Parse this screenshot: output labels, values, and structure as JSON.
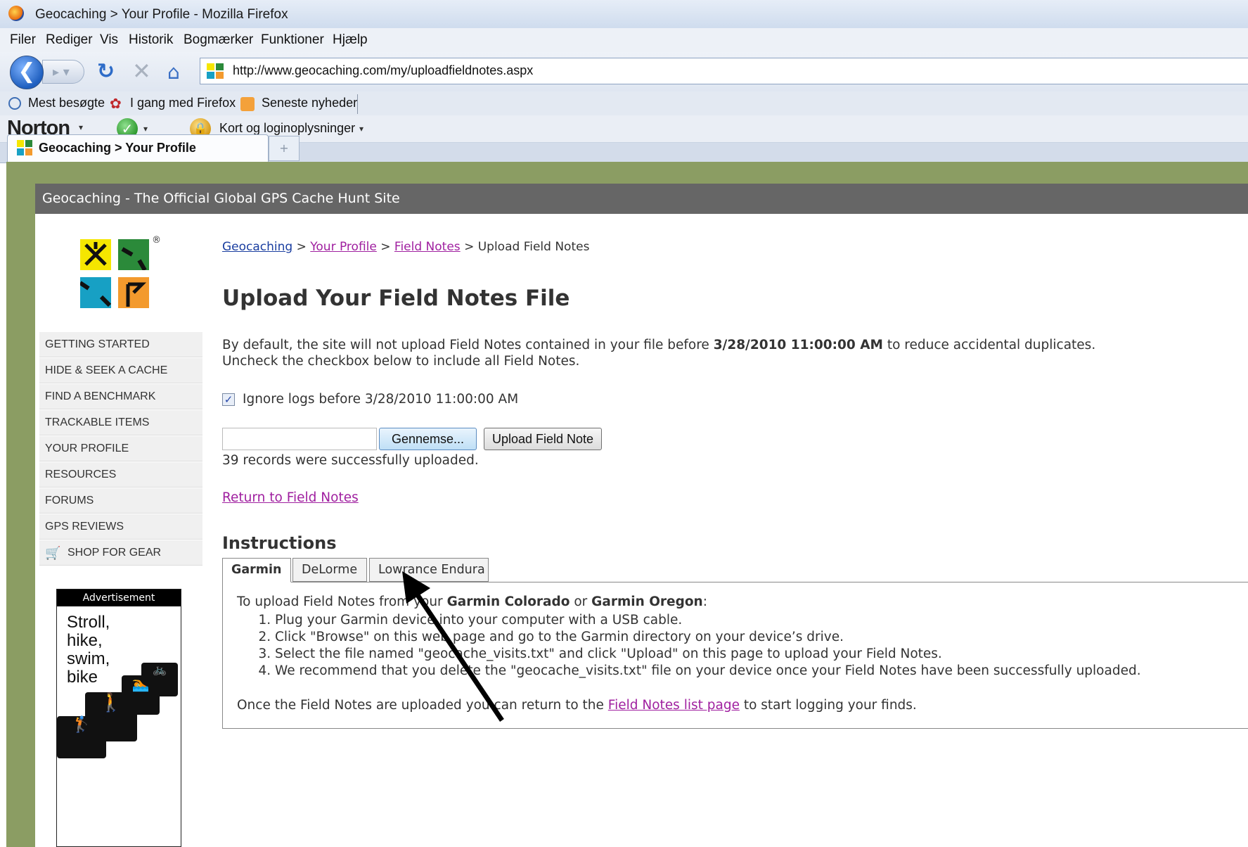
{
  "window": {
    "title": "Geocaching > Your Profile - Mozilla Firefox"
  },
  "menubar": {
    "items": [
      "Filer",
      "Rediger",
      "Vis",
      "Historik",
      "Bogmærker",
      "Funktioner",
      "Hjælp"
    ]
  },
  "navbar": {
    "url": "http://www.geocaching.com/my/uploadfieldnotes.aspx"
  },
  "bookmarks": {
    "items": [
      "Mest besøgte",
      "I gang med Firefox",
      "Seneste nyheder"
    ]
  },
  "norton": {
    "logo": "Norton",
    "cards_label": "Kort og loginoplysninger"
  },
  "tab": {
    "label": "Geocaching > Your Profile"
  },
  "site": {
    "header": "Geocaching - The Official Global GPS Cache Hunt Site",
    "logo_colors": [
      "#f5e600",
      "#2b8a3a",
      "#17a0c4",
      "#f39a2d"
    ]
  },
  "sidebar": {
    "items": [
      "GETTING STARTED",
      "HIDE & SEEK A CACHE",
      "FIND A BENCHMARK",
      "TRACKABLE ITEMS",
      "YOUR PROFILE",
      "RESOURCES",
      "FORUMS",
      "GPS REVIEWS",
      "SHOP FOR GEAR"
    ]
  },
  "ad": {
    "header": "Advertisement",
    "text": "Stroll,\nhike,\nswim,\nbike"
  },
  "breadcrumb": {
    "home": "Geocaching",
    "profile": "Your Profile",
    "notes": "Field Notes",
    "current": "Upload Field Notes",
    "sep": ">"
  },
  "main": {
    "title": "Upload Your Field Notes File",
    "para_pre": "By default, the site will not upload Field Notes contained in your file before ",
    "para_date": "3/28/2010 11:00:00 AM",
    "para_post": " to reduce accidental duplicates. Uncheck the checkbox below to include all Field Notes.",
    "ignore_label": "Ignore logs before 3/28/2010 11:00:00 AM",
    "ignore_checked": true,
    "browse_label": "Gennemse...",
    "upload_label": "Upload Field Note",
    "status": "39 records were successfully uploaded.",
    "return_link": "Return to Field Notes"
  },
  "instructions": {
    "title": "Instructions",
    "tabs": [
      "Garmin",
      "DeLorme",
      "Lowrance Endura"
    ],
    "intro_pre": "To upload Field Notes from your ",
    "intro_dev1": "Garmin Colorado",
    "intro_or": " or ",
    "intro_dev2": "Garmin Oregon",
    "intro_post": ":",
    "steps": [
      "Plug your Garmin device into your computer with a USB cable.",
      "Click \"Browse\" on this web page and go to the Garmin directory on your device’s drive.",
      "Select the file named \"geocache_visits.txt\" and click \"Upload\" on this page to upload your Field Notes.",
      "We recommend that you delete the \"geocache_visits.txt\" file on your device once your Field Notes have been successfully uploaded."
    ],
    "outro_pre": "Once the Field Notes are uploaded you can return to the ",
    "outro_link": "Field Notes list page",
    "outro_post": " to start logging your finds."
  }
}
